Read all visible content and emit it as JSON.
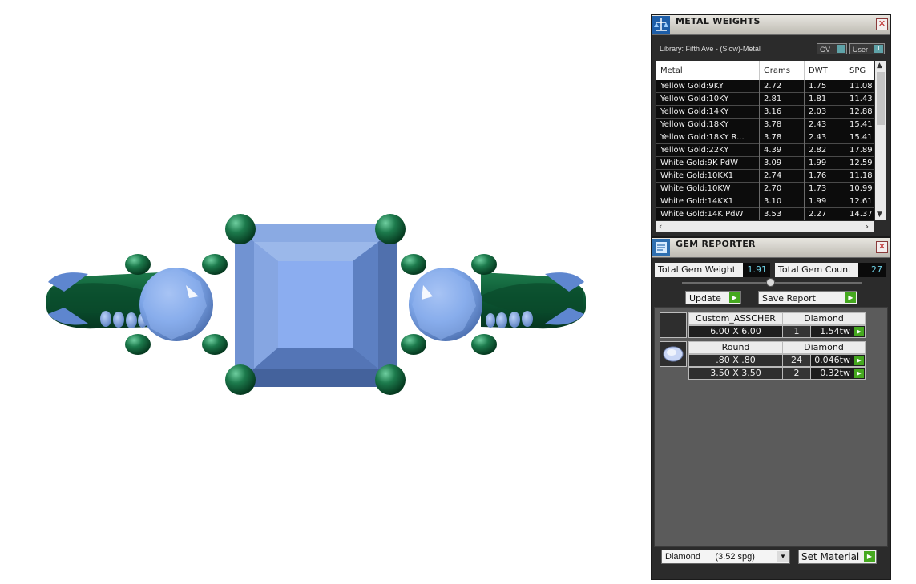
{
  "metal_weights": {
    "title": "METAL WEIGHTS",
    "library_label": "Library: Fifth Ave - (Slow)-Metal",
    "gv_label": "GV",
    "user_label": "User",
    "indicator": "I",
    "columns": [
      "Metal",
      "Grams",
      "DWT",
      "SPG"
    ],
    "rows": [
      {
        "metal": "Yellow Gold:9KY",
        "grams": "2.72",
        "dwt": "1.75",
        "spg": "11.08"
      },
      {
        "metal": "Yellow Gold:10KY",
        "grams": "2.81",
        "dwt": "1.81",
        "spg": "11.43"
      },
      {
        "metal": "Yellow Gold:14KY",
        "grams": "3.16",
        "dwt": "2.03",
        "spg": "12.88"
      },
      {
        "metal": "Yellow Gold:18KY",
        "grams": "3.78",
        "dwt": "2.43",
        "spg": "15.41"
      },
      {
        "metal": "Yellow Gold:18KY R...",
        "grams": "3.78",
        "dwt": "2.43",
        "spg": "15.41"
      },
      {
        "metal": "Yellow Gold:22KY",
        "grams": "4.39",
        "dwt": "2.82",
        "spg": "17.89"
      },
      {
        "metal": "White Gold:9K PdW",
        "grams": "3.09",
        "dwt": "1.99",
        "spg": "12.59"
      },
      {
        "metal": "White Gold:10KX1",
        "grams": "2.74",
        "dwt": "1.76",
        "spg": "11.18"
      },
      {
        "metal": "White Gold:10KW",
        "grams": "2.70",
        "dwt": "1.73",
        "spg": "10.99"
      },
      {
        "metal": "White Gold:14KX1",
        "grams": "3.10",
        "dwt": "1.99",
        "spg": "12.61"
      },
      {
        "metal": "White Gold:14K PdW",
        "grams": "3.53",
        "dwt": "2.27",
        "spg": "14.37"
      }
    ]
  },
  "gem_reporter": {
    "title": "GEM REPORTER",
    "total_weight_label": "Total Gem Weight",
    "total_weight_value": "1.91",
    "total_count_label": "Total Gem Count",
    "total_count_value": "27",
    "update_label": "Update",
    "save_report_label": "Save Report",
    "gems": [
      {
        "shape": "Custom_ASSCHER",
        "material": "Diamond",
        "sizes": [
          {
            "size": "6.00 X 6.00",
            "count": "1",
            "ctw": "1.54tw"
          }
        ]
      },
      {
        "shape": "Round",
        "material": "Diamond",
        "sizes": [
          {
            "size": ".80 X .80",
            "count": "24",
            "ctw": "0.046tw"
          },
          {
            "size": "3.50 X 3.50",
            "count": "2",
            "ctw": "0.32tw"
          }
        ]
      }
    ],
    "material_select": "Diamond      (3.52 spg)",
    "set_material_label": "Set Material"
  },
  "colors": {
    "metal": "#0d5a34",
    "gem": "#7ea6e8",
    "accent_go": "#45a81f",
    "value_text": "#6fd3e8"
  }
}
